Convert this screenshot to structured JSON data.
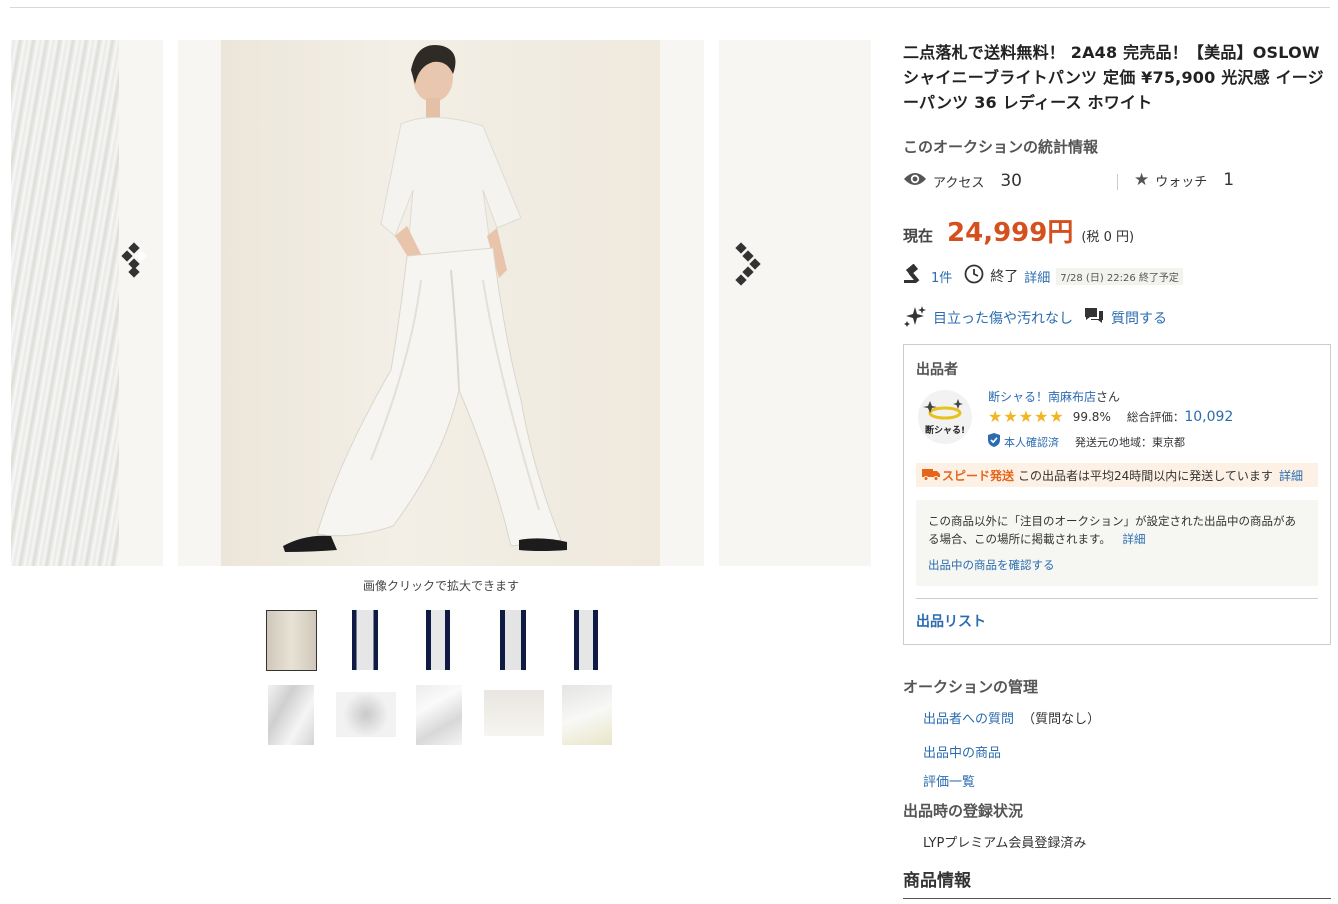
{
  "gallery": {
    "hint": "画像クリックで拡大できます"
  },
  "item": {
    "title": "二点落札で送料無料！ 2A48 完売品！【美品】OSLOW シャイニーブライトパンツ 定価 ¥75,900 光沢感 イージーパンツ 36 レディース ホワイト"
  },
  "stats": {
    "heading": "このオークションの統計情報",
    "access_label": "アクセス",
    "access_value": "30",
    "watch_label": "ウォッチ",
    "watch_value": "1"
  },
  "price": {
    "label": "現在",
    "value": "24,999円",
    "tax": "(税 0 円)"
  },
  "bid": {
    "count": "1件",
    "end_label": "終了",
    "detail_link": "詳細",
    "end_time": "7/28 (日) 22:26 終了予定"
  },
  "condition": {
    "text": "目立った傷や汚れなし",
    "question": "質問する"
  },
  "seller": {
    "heading": "出品者",
    "name": "断シャる！南麻布店",
    "suffix": "さん",
    "stars": "★★★★★",
    "rating_pct": "99.8%",
    "total_label": "総合評価：",
    "total_value": "10,092",
    "verified": "本人確認済",
    "region": "発送元の地域：東京都",
    "avatar_text": "断シャる!",
    "speed_label": "スピード発送",
    "speed_text": "この出品者は平均24時間以内に発送しています",
    "speed_detail": "詳細",
    "notice_text": "この商品以外に「注目のオークション」が設定された出品中の商品がある場合、この場所に掲載されます。",
    "notice_detail": "詳細",
    "notice_link": "出品中の商品を確認する",
    "list_link": "出品リスト"
  },
  "management": {
    "heading": "オークションの管理",
    "q_link": "出品者への質問",
    "q_note": "（質問なし）",
    "items_link": "出品中の商品",
    "reviews_link": "評価一覧"
  },
  "registration": {
    "heading": "出品時の登録状況",
    "value": "LYPプレミアム会員登録済み"
  },
  "product_info": {
    "heading": "商品情報"
  },
  "colors": {
    "price": "#d4501e",
    "link": "#2b6cb0",
    "star": "#f2b524",
    "speed": "#e5661b"
  }
}
